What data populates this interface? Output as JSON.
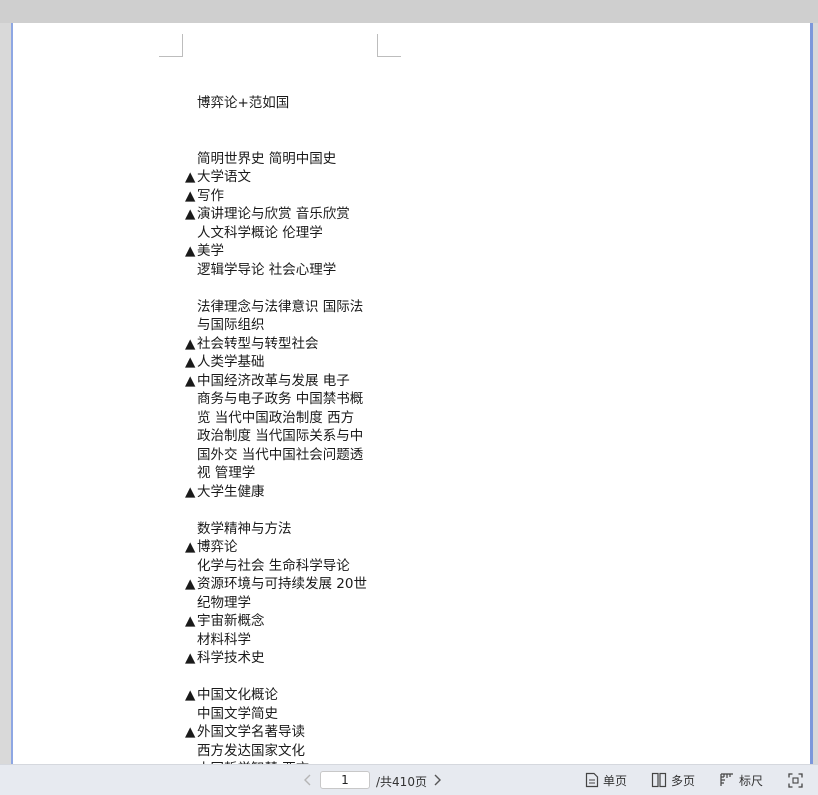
{
  "document": {
    "lines": [
      {
        "marker": "",
        "text": "博弈论+范如国"
      },
      {
        "marker": "",
        "text": ""
      },
      {
        "marker": "",
        "text": ""
      },
      {
        "marker": "",
        "text": "简明世界史  简明中国史"
      },
      {
        "marker": "▲",
        "text": "大学语文"
      },
      {
        "marker": "▲",
        "text": "写作"
      },
      {
        "marker": "▲",
        "text": "演讲理论与欣赏  音乐欣赏"
      },
      {
        "marker": "",
        "text": "人文科学概论  伦理学"
      },
      {
        "marker": "▲",
        "text": "美学"
      },
      {
        "marker": "",
        "text": "逻辑学导论  社会心理学"
      },
      {
        "marker": "",
        "text": ""
      },
      {
        "marker": "",
        "text": "法律理念与法律意识  国际法"
      },
      {
        "marker": "",
        "text": "与国际组织"
      },
      {
        "marker": "▲",
        "text": "社会转型与转型社会"
      },
      {
        "marker": "▲",
        "text": "人类学基础"
      },
      {
        "marker": "▲",
        "text": "中国经济改革与发展  电子"
      },
      {
        "marker": "",
        "text": "商务与电子政务  中国禁书概"
      },
      {
        "marker": "",
        "text": "览  当代中国政治制度  西方"
      },
      {
        "marker": "",
        "text": "政治制度  当代国际关系与中"
      },
      {
        "marker": "",
        "text": "国外交  当代中国社会问题透"
      },
      {
        "marker": "",
        "text": "视  管理学"
      },
      {
        "marker": "▲",
        "text": "大学生健康"
      },
      {
        "marker": "",
        "text": ""
      },
      {
        "marker": "",
        "text": "数学精神与方法"
      },
      {
        "marker": "▲",
        "text": "博弈论"
      },
      {
        "marker": "",
        "text": "化学与社会  生命科学导论"
      },
      {
        "marker": "▲",
        "text": "资源环境与可持续发展  20世"
      },
      {
        "marker": "",
        "text": "纪物理学"
      },
      {
        "marker": "▲",
        "text": "宇宙新概念"
      },
      {
        "marker": "",
        "text": "材料科学"
      },
      {
        "marker": "▲",
        "text": "科学技术史"
      },
      {
        "marker": "",
        "text": ""
      },
      {
        "marker": "▲",
        "text": "中国文化概论"
      },
      {
        "marker": "",
        "text": "中国文学简史"
      },
      {
        "marker": "▲",
        "text": "外国文学名著导读"
      },
      {
        "marker": "",
        "text": "西方发达国家文化"
      },
      {
        "marker": "",
        "text": "中国哲学智慧  西方"
      }
    ]
  },
  "statusbar": {
    "prev_icon": "chevron-left-icon",
    "next_icon": "chevron-right-icon",
    "current_page": "1",
    "page_total": "/共410页",
    "single_page_label": "单页",
    "multi_page_label": "多页",
    "ruler_label": "标尺",
    "fit_icon": "fit-screen-icon"
  }
}
